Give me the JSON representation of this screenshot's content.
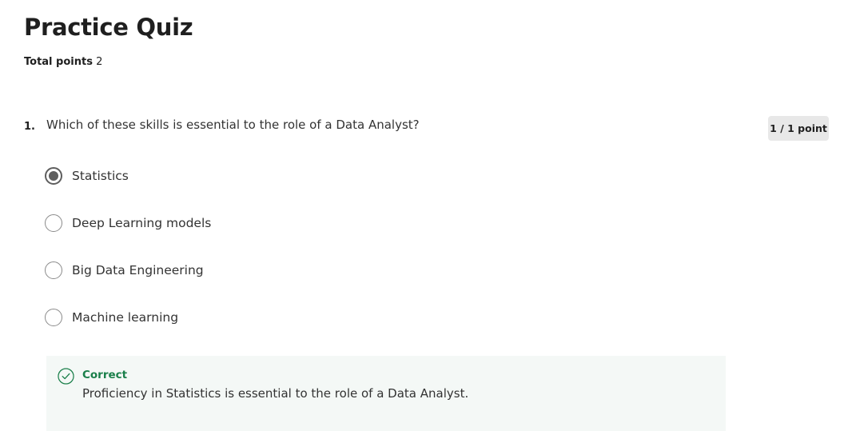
{
  "quiz": {
    "title": "Practice Quiz",
    "total_points_label": "Total points",
    "total_points_value": "2"
  },
  "question": {
    "number": "1.",
    "prompt": "Which of these skills is essential to the role of a Data Analyst?",
    "points": "1 / 1 point",
    "options": [
      {
        "label": "Statistics",
        "selected": true
      },
      {
        "label": "Deep Learning models",
        "selected": false
      },
      {
        "label": "Big Data Engineering",
        "selected": false
      },
      {
        "label": "Machine learning",
        "selected": false
      }
    ],
    "feedback": {
      "icon": "check-circle-icon",
      "status": "Correct",
      "text": "Proficiency in Statistics is essential to the role of a Data Analyst."
    }
  },
  "colors": {
    "correct": "#1a7f4a",
    "feedback_bg": "#f4f8f6",
    "badge_bg": "#e8e8e8",
    "selected_radio": "#5e5e5e"
  }
}
